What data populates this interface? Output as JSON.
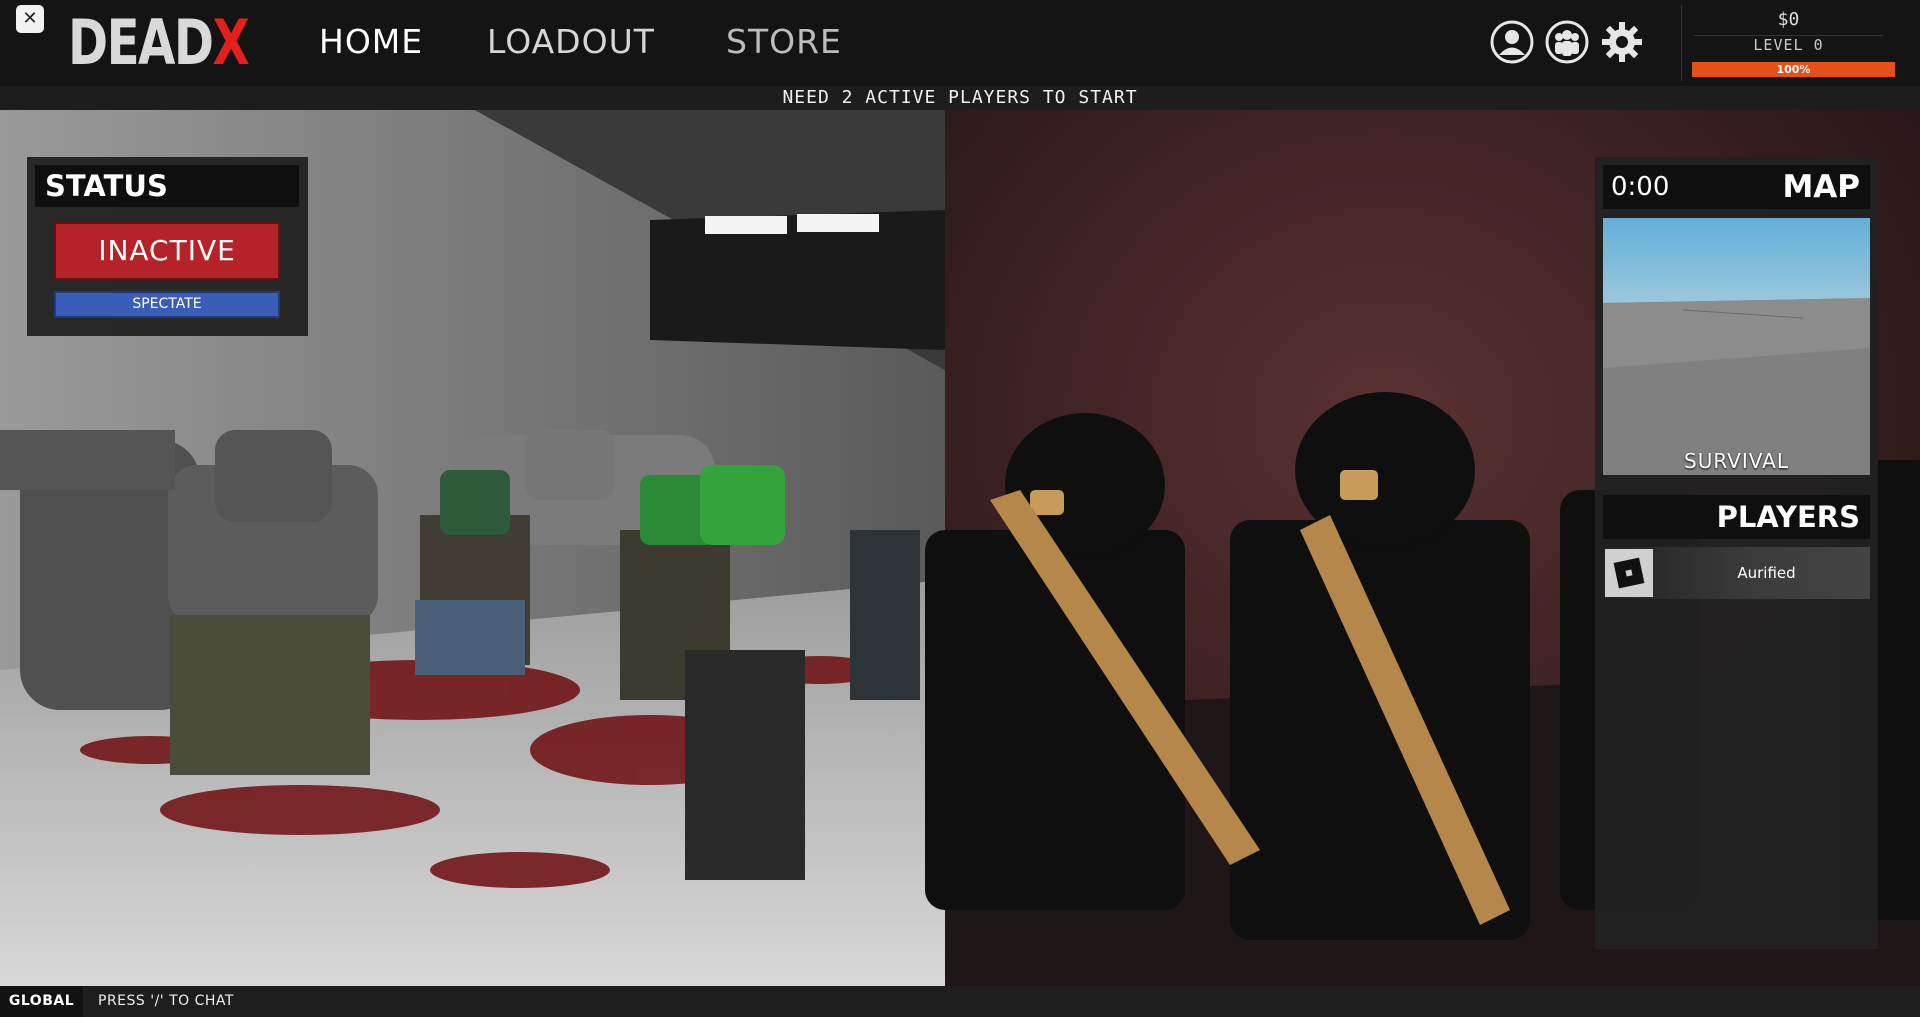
{
  "header": {
    "close_label": "✕",
    "logo_part1": "DEAD",
    "logo_part2": "X",
    "nav": {
      "home": "HOME",
      "loadout": "LOADOUT",
      "store": "STORE"
    },
    "icons": [
      "profile-icon",
      "group-icon",
      "gear-icon"
    ]
  },
  "currency": {
    "money": "$0",
    "level": "LEVEL 0",
    "xp_percent": 100,
    "xp_label": "100%"
  },
  "notice": "NEED 2 ACTIVE PLAYERS TO START",
  "status": {
    "title": "STATUS",
    "state": "INACTIVE",
    "spectate": "SPECTATE"
  },
  "map": {
    "timer": "0:00",
    "title": "MAP",
    "mode": "SURVIVAL"
  },
  "players": {
    "title": "PLAYERS",
    "list": [
      {
        "name": "Aurified"
      }
    ]
  },
  "chat": {
    "channel": "GLOBAL",
    "hint": "PRESS '/' TO CHAT"
  },
  "colors": {
    "accent_red": "#e51e1e",
    "inactive_red": "#b5222a",
    "spectate_blue": "#3a5eb8",
    "xp_orange": "#e2521a"
  }
}
